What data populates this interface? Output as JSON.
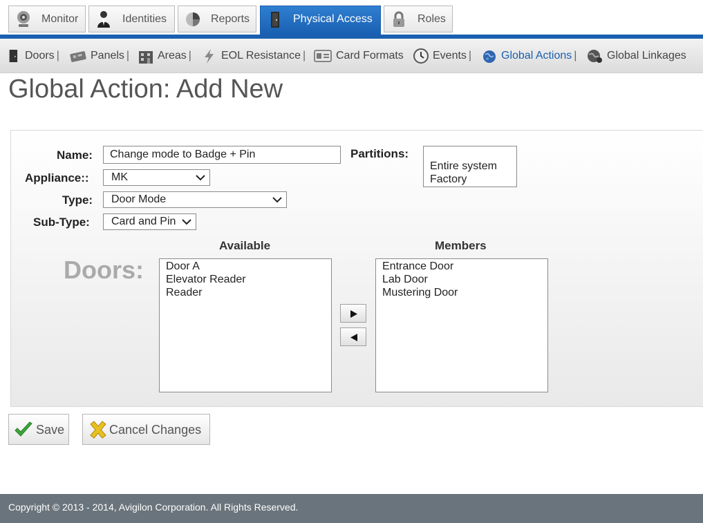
{
  "top_tabs": [
    {
      "label": "Monitor",
      "icon": "webcam-icon"
    },
    {
      "label": "Identities",
      "icon": "person-icon"
    },
    {
      "label": "Reports",
      "icon": "pie-chart-icon"
    },
    {
      "label": "Physical Access",
      "icon": "door-icon",
      "active": true
    },
    {
      "label": "Roles",
      "icon": "lock-icon"
    }
  ],
  "sub_nav": [
    {
      "label": "Doors",
      "icon": "door-icon",
      "sep": "|"
    },
    {
      "label": "Panels",
      "icon": "panel-board-icon",
      "sep": "|"
    },
    {
      "label": "Areas",
      "icon": "building-icon",
      "sep": "|"
    },
    {
      "label": "EOL Resistance",
      "icon": "lightning-icon",
      "sep": "|"
    },
    {
      "label": "Card Formats",
      "icon": "id-card-icon",
      "sep": ""
    },
    {
      "label": "Events",
      "icon": "clock-icon",
      "sep": "|"
    },
    {
      "label": "Global Actions",
      "icon": "globe-icon",
      "sep": "|",
      "active": true
    },
    {
      "label": "Global Linkages",
      "icon": "globe-link-icon",
      "sep": ""
    }
  ],
  "page": {
    "title": "Global Action: Add New"
  },
  "form": {
    "name_label": "Name:",
    "name_value": "Change mode to Badge + Pin",
    "partitions_label": "Partitions:",
    "partitions_options": [
      "Entire system",
      "Factory"
    ],
    "appliance_label": "Appliance::",
    "appliance_value": "MK",
    "type_label": "Type:",
    "type_value": "Door Mode",
    "subtype_label": "Sub-Type:",
    "subtype_value": "Card and Pin",
    "doors_label": "Doors:",
    "available_header": "Available",
    "members_header": "Members",
    "available_items": [
      "Door A",
      "Elevator Reader",
      "Reader"
    ],
    "member_items": [
      "Entrance Door",
      "Lab Door",
      "Mustering Door"
    ]
  },
  "actions": {
    "save_label": "Save",
    "cancel_label": "Cancel Changes"
  },
  "footer": {
    "copyright": "Copyright © 2013 - 2014, Avigilon Corporation. All Rights Reserved."
  },
  "colors": {
    "accent": "#1a5fb0",
    "footer_bg": "#6a747c",
    "save_check": "#3aa83a",
    "cancel_x": "#e8c020"
  }
}
